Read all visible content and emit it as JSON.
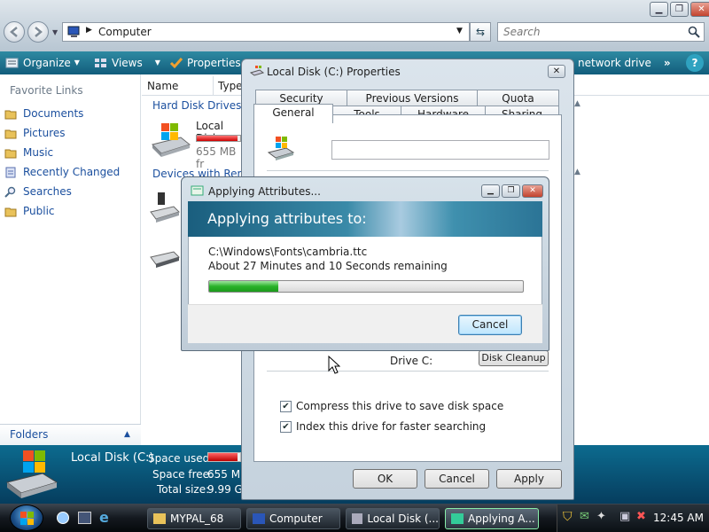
{
  "explorer": {
    "address": "Computer",
    "search_placeholder": "Search",
    "toolbar": {
      "organize": "Organize",
      "views": "Views",
      "properties": "Properties",
      "network_drive": "network drive",
      "more": "»"
    },
    "favorite_links_title": "Favorite Links",
    "favorite_links": [
      {
        "label": "Documents",
        "icon": "folder-icon"
      },
      {
        "label": "Pictures",
        "icon": "folder-icon"
      },
      {
        "label": "Music",
        "icon": "folder-icon"
      },
      {
        "label": "Recently Changed",
        "icon": "recent-icon"
      },
      {
        "label": "Searches",
        "icon": "search-icon"
      },
      {
        "label": "Public",
        "icon": "folder-icon"
      }
    ],
    "folders_label": "Folders",
    "columns": {
      "name": "Name",
      "type": "Type"
    },
    "groups": {
      "hard_disk": "Hard Disk Drives (1",
      "removable": "Devices with Remo"
    },
    "drive": {
      "name": "Local Disk",
      "free": "655 MB fr",
      "used_fraction": 0.93
    },
    "details": {
      "title": "Local Disk (C:)",
      "space_used_label": "Space used:",
      "space_free_label": "Space free:",
      "space_free_value": "655 ME",
      "total_label": "Total size:",
      "total_value": "9.99 GE",
      "used_fraction": 0.93
    }
  },
  "taskbar": {
    "items": [
      {
        "label": "MYPAL_68",
        "icon": "folder-icon"
      },
      {
        "label": "Computer",
        "icon": "computer-icon"
      },
      {
        "label": "Local Disk (...",
        "icon": "drive-icon"
      },
      {
        "label": "Applying A...",
        "icon": "dialog-icon",
        "active": true
      }
    ],
    "clock": "12:45 AM"
  },
  "properties_dialog": {
    "title": "Local Disk (C:) Properties",
    "tabs_row1": [
      "Security",
      "Previous Versions",
      "Quota"
    ],
    "tabs_row2": [
      "General",
      "Tools",
      "Hardware",
      "Sharing"
    ],
    "active_tab": "General",
    "label_value": "",
    "drive_label": "Drive C:",
    "disk_cleanup": "Disk Cleanup",
    "compress": {
      "label": "Compress this drive to save disk space",
      "checked": true
    },
    "index": {
      "label": "Index this drive for faster searching",
      "checked": true
    },
    "buttons": {
      "ok": "OK",
      "cancel": "Cancel",
      "apply": "Apply"
    }
  },
  "applying_dialog": {
    "title": "Applying Attributes...",
    "heading": "Applying attributes to:",
    "file": "C:\\Windows\\Fonts\\cambria.ttc",
    "remaining": "About 27 Minutes and 10 Seconds remaining",
    "progress": 0.22,
    "cancel": "Cancel"
  }
}
